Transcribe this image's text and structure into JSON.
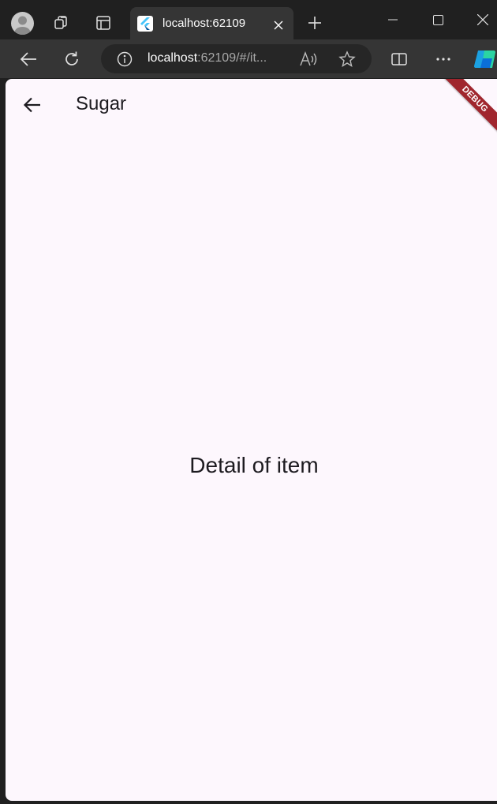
{
  "tab": {
    "title": "localhost:62109"
  },
  "address_bar": {
    "host": "localhost",
    "rest": ":62109/#/it..."
  },
  "app": {
    "title": "Sugar",
    "body_text": "Detail of item",
    "debug_banner": "DEBUG"
  },
  "colors": {
    "page_background": "#fdf7fd",
    "browser_dark": "#202020",
    "toolbar": "#353535",
    "debug_banner": "#a0262e",
    "text": "#1d1b20"
  },
  "icons": {
    "profile": "profile-avatar-icon",
    "workspaces": "workspaces-icon",
    "tab_actions": "tab-actions-icon",
    "favicon": "flutter-logo-icon",
    "tab_close": "close-icon",
    "new_tab": "plus-icon",
    "minimize": "minimize-icon",
    "maximize": "maximize-icon",
    "window_close": "close-icon",
    "back": "back-arrow-icon",
    "refresh": "refresh-icon",
    "site_info": "info-icon",
    "read_aloud": "read-aloud-icon",
    "favorite": "star-icon",
    "split_screen": "split-screen-icon",
    "more": "more-icon",
    "copilot": "copilot-icon",
    "app_back": "back-arrow-icon"
  }
}
